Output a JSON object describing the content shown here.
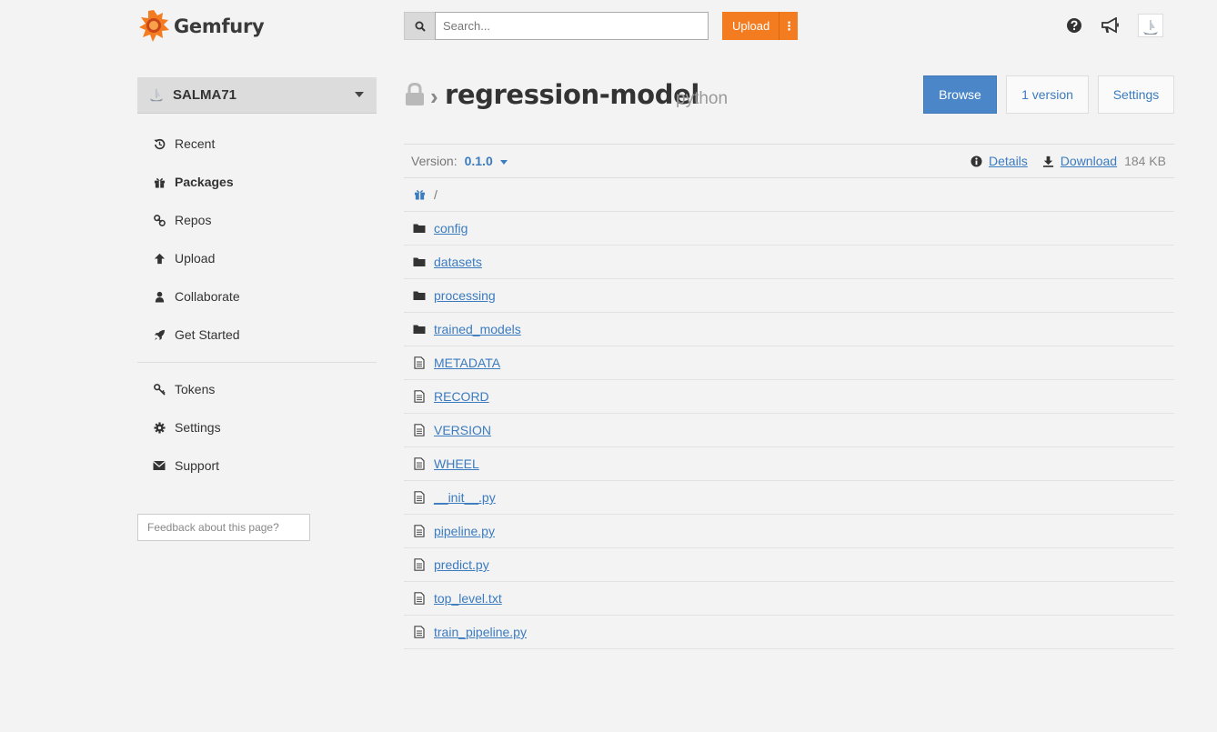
{
  "header": {
    "brand": "Gemfury",
    "search_placeholder": "Search...",
    "upload_label": "Upload",
    "upload_menu": "⋮"
  },
  "sidebar": {
    "account": "SALMA71",
    "items": [
      {
        "label": "Recent",
        "icon": "history-icon"
      },
      {
        "label": "Packages",
        "icon": "gift-icon",
        "active": true
      },
      {
        "label": "Repos",
        "icon": "repo-link-icon"
      },
      {
        "label": "Upload",
        "icon": "upload-arrow-icon"
      },
      {
        "label": "Collaborate",
        "icon": "user-icon"
      },
      {
        "label": "Get Started",
        "icon": "rocket-icon"
      }
    ],
    "items2": [
      {
        "label": "Tokens",
        "icon": "key-icon"
      },
      {
        "label": "Settings",
        "icon": "gear-icon"
      },
      {
        "label": "Support",
        "icon": "envelope-icon"
      }
    ],
    "feedback_placeholder": "Feedback about this page?"
  },
  "package": {
    "separator": "›",
    "name": "regression-model",
    "kind": "python",
    "buttons": {
      "browse": "Browse",
      "versions": "1 version",
      "settings": "Settings"
    }
  },
  "version_bar": {
    "label": "Version:",
    "value": "0.1.0",
    "details": "Details",
    "download": "Download",
    "size": "184 KB"
  },
  "files": {
    "root_path": "/",
    "entries": [
      {
        "name": "config",
        "type": "folder"
      },
      {
        "name": "datasets",
        "type": "folder"
      },
      {
        "name": "processing",
        "type": "folder"
      },
      {
        "name": "trained_models",
        "type": "folder"
      },
      {
        "name": "METADATA",
        "type": "file"
      },
      {
        "name": "RECORD",
        "type": "file"
      },
      {
        "name": "VERSION",
        "type": "file"
      },
      {
        "name": "WHEEL",
        "type": "file"
      },
      {
        "name": "__init__.py",
        "type": "file"
      },
      {
        "name": "pipeline.py",
        "type": "file"
      },
      {
        "name": "predict.py",
        "type": "file"
      },
      {
        "name": "top_level.txt",
        "type": "file"
      },
      {
        "name": "train_pipeline.py",
        "type": "file"
      }
    ]
  },
  "colors": {
    "accent": "#f47c20",
    "link": "#3b7bbf",
    "primary_button": "#4a86c8"
  }
}
